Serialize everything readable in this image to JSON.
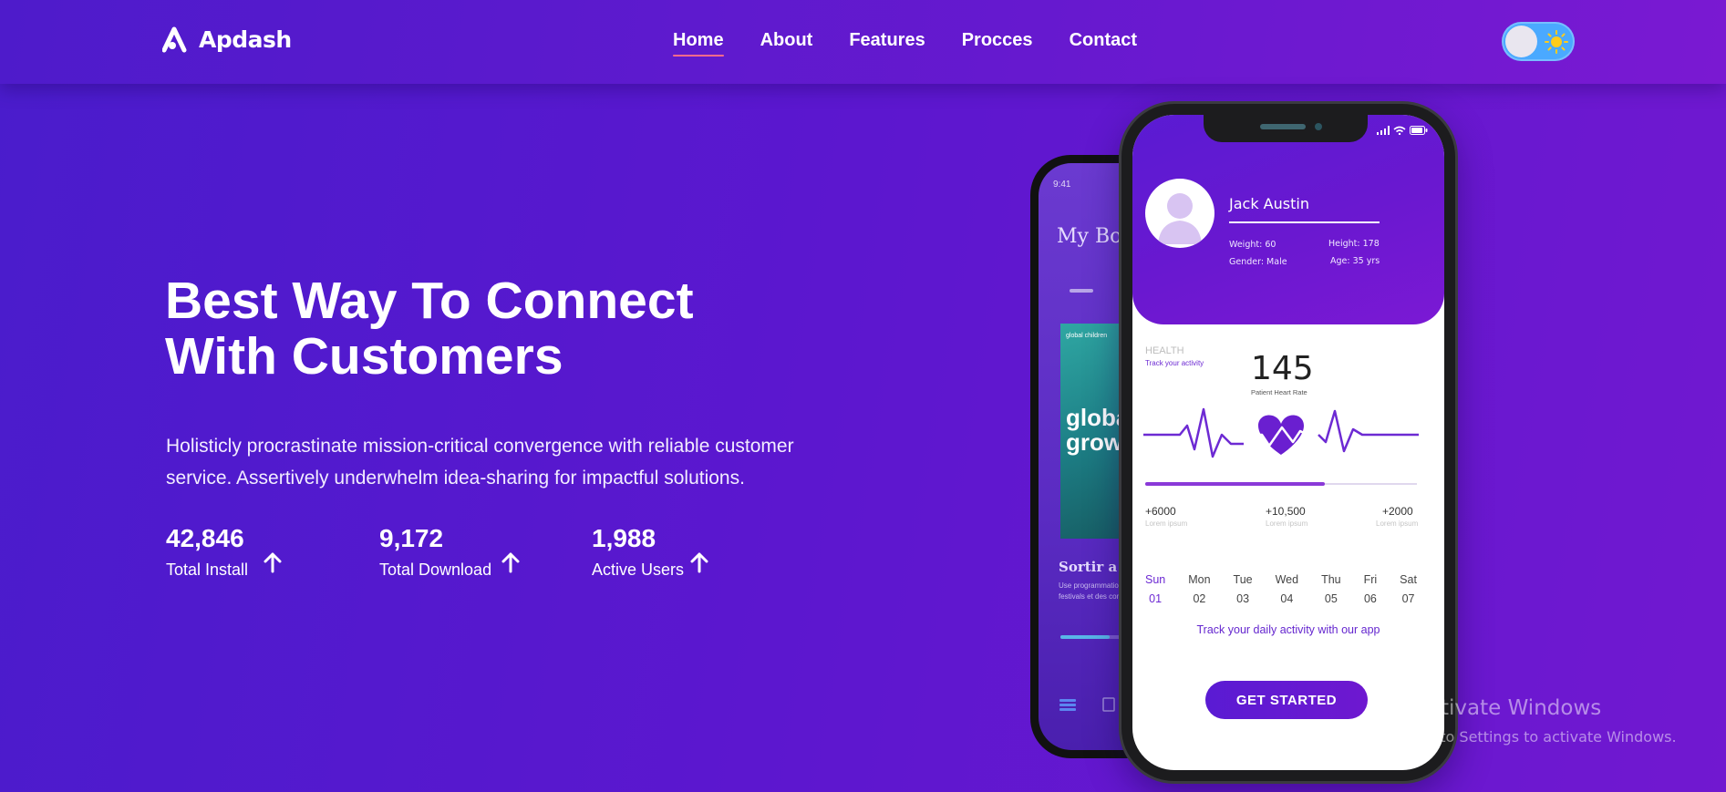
{
  "brand": {
    "name": "Apdash"
  },
  "nav": {
    "items": [
      {
        "label": "Home",
        "active": true
      },
      {
        "label": "About",
        "active": false
      },
      {
        "label": "Features",
        "active": false
      },
      {
        "label": "Procces",
        "active": false
      },
      {
        "label": "Contact",
        "active": false
      }
    ],
    "theme_toggle": {
      "state": "light",
      "icon": "sun-icon"
    }
  },
  "hero": {
    "title_line1": "Best Way To Connect",
    "title_line2": "With Customers",
    "description": "Holisticly procrastinate mission-critical convergence with reliable customer service. Assertively underwhelm idea-sharing for impactful solutions.",
    "stats": [
      {
        "value": "42,846",
        "label": "Total Install",
        "icon": "arrow-up-icon"
      },
      {
        "value": "9,172",
        "label": "Total Download",
        "icon": "arrow-up-icon"
      },
      {
        "value": "1,988",
        "label": "Active Users",
        "icon": "arrow-up-icon"
      }
    ]
  },
  "phone_back": {
    "time": "9:41",
    "title": "My Booke",
    "book_small": "global children",
    "book_text": "global growth",
    "subtitle": "Sortir a Canne",
    "description": "Use programmation. Pub festivals et des con"
  },
  "phone_front": {
    "profile": {
      "name": "Jack Austin",
      "weight": "Weight:  60",
      "height": "Height:  178",
      "gender": "Gender:  Male",
      "age": "Age:  35 yrs"
    },
    "health_label": "HEALTH",
    "track_label": "Track your activity",
    "heart_rate": "145",
    "heart_caption": "Patient Heart Rate",
    "progress": 0.66,
    "mini_stats": [
      {
        "value": "+6000",
        "sub": "Lorem ipsum"
      },
      {
        "value": "+10,500",
        "sub": "Lorem ipsum"
      },
      {
        "value": "+2000",
        "sub": "Lorem ipsum"
      }
    ],
    "days": [
      {
        "day": "Sun",
        "num": "01",
        "active": true
      },
      {
        "day": "Mon",
        "num": "02",
        "active": false
      },
      {
        "day": "Tue",
        "num": "03",
        "active": false
      },
      {
        "day": "Wed",
        "num": "04",
        "active": false
      },
      {
        "day": "Thu",
        "num": "05",
        "active": false
      },
      {
        "day": "Fri",
        "num": "06",
        "active": false
      },
      {
        "day": "Sat",
        "num": "07",
        "active": false
      }
    ],
    "tagline": "Track your daily activity with our app",
    "cta": "GET STARTED"
  },
  "watermark": {
    "title": "Activate Windows",
    "subtitle": "Go to Settings to activate Windows."
  },
  "colors": {
    "background_start": "#4a1ccc",
    "background_end": "#7118d0",
    "nav_active_underline": "#ff6b8b",
    "toggle": "#4aa9ff",
    "accent": "#6d2ad3"
  }
}
